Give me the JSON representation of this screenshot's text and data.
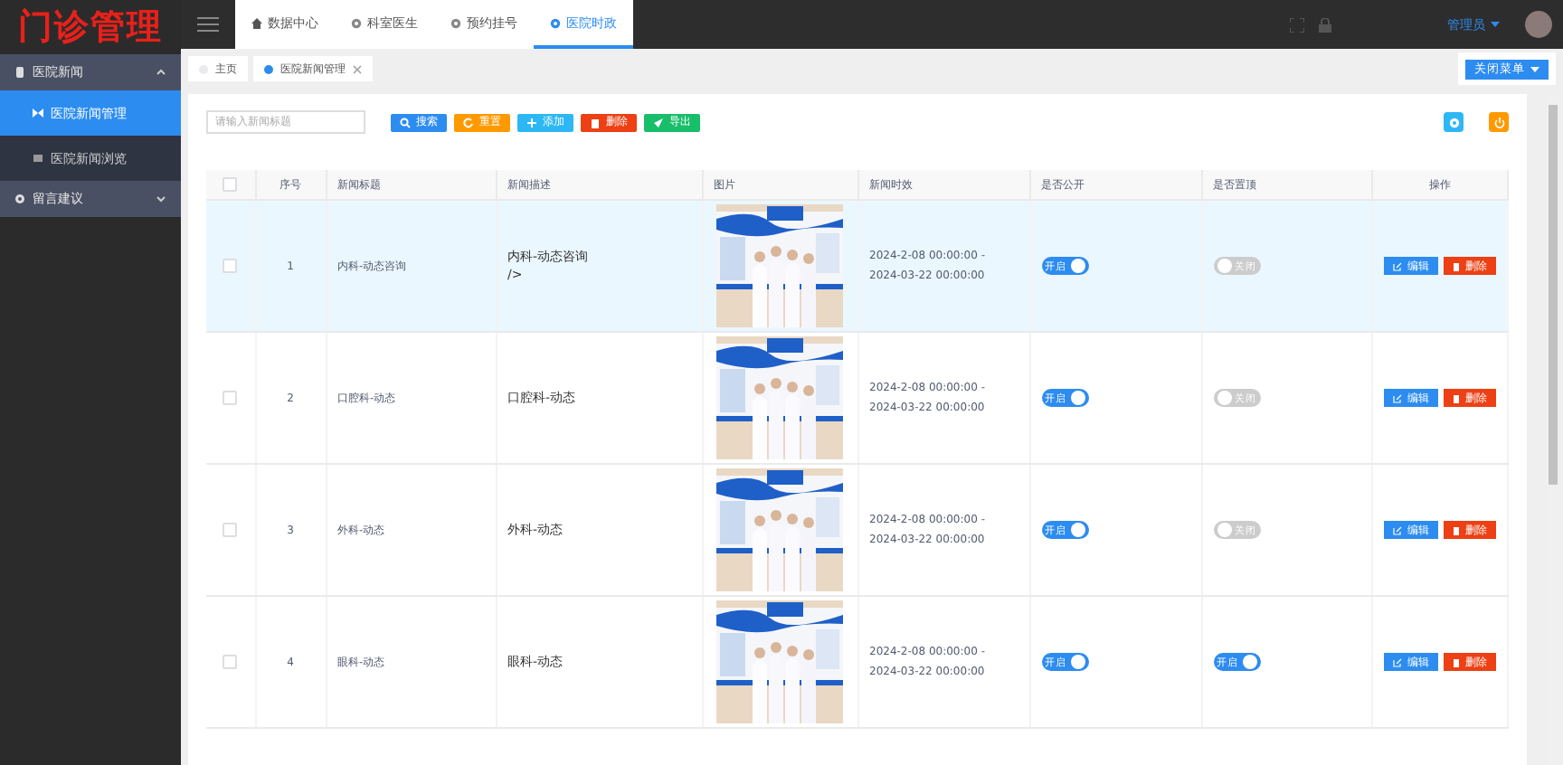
{
  "logo": "门诊管理",
  "sidebar": {
    "items": [
      {
        "label": "医院新闻",
        "expanded": true,
        "children": [
          {
            "label": "医院新闻管理",
            "selected": true
          },
          {
            "label": "医院新闻浏览",
            "selected": false
          }
        ]
      },
      {
        "label": "留言建议",
        "expanded": false
      }
    ]
  },
  "top_nav": [
    {
      "label": "数据中心",
      "selected": false
    },
    {
      "label": "科室医生",
      "selected": false
    },
    {
      "label": "预约挂号",
      "selected": false
    },
    {
      "label": "医院时政",
      "selected": true
    }
  ],
  "user": {
    "name": "管理员"
  },
  "tags": [
    {
      "label": "主页",
      "selected": false,
      "closable": false
    },
    {
      "label": "医院新闻管理",
      "selected": true,
      "closable": true
    }
  ],
  "close_menu_button": "关闭菜单",
  "search": {
    "placeholder": "请输入新闻标题"
  },
  "buttons": [
    {
      "label": "搜索",
      "kind": "primary"
    },
    {
      "label": "重置",
      "kind": "warning"
    },
    {
      "label": "添加",
      "kind": "info"
    },
    {
      "label": "删除",
      "kind": "danger"
    },
    {
      "label": "导出",
      "kind": "success"
    }
  ],
  "table": {
    "all_checked": false,
    "columns": [
      "序号",
      "新闻标题",
      "新闻描述",
      "图片",
      "新闻时效",
      "是否公开",
      "是否置顶",
      "操作"
    ],
    "rows": [
      {
        "no": "1",
        "title": "内科-动态咨询",
        "description": "内科-动态咨询\n/>",
        "period": "2024-2-08 00:00:00 - 2024-03-22 00:00:00",
        "public": true,
        "public_label": "开启",
        "top": false,
        "top_label": "关闭",
        "edit": "编辑",
        "delete": "删除",
        "selected": true,
        "checked": false
      },
      {
        "no": "2",
        "title": "口腔科-动态",
        "description": "口腔科-动态",
        "period": "2024-2-08 00:00:00 - 2024-03-22 00:00:00",
        "public": true,
        "public_label": "开启",
        "top": false,
        "top_label": "关闭",
        "edit": "编辑",
        "delete": "删除",
        "selected": false,
        "checked": false
      },
      {
        "no": "3",
        "title": "外科-动态",
        "description": "外科-动态",
        "period": "2024-2-08 00:00:00 - 2024-03-22 00:00:00",
        "public": true,
        "public_label": "开启",
        "top": false,
        "top_label": "关闭",
        "edit": "编辑",
        "delete": "删除",
        "selected": false,
        "checked": false
      },
      {
        "no": "4",
        "title": "眼科-动态",
        "description": "眼科-动态",
        "period": "2024-2-08 00:00:00 - 2024-03-22 00:00:00",
        "public": true,
        "public_label": "开启",
        "top": true,
        "top_label": "开启",
        "edit": "编辑",
        "delete": "删除",
        "selected": false,
        "checked": false
      }
    ]
  }
}
